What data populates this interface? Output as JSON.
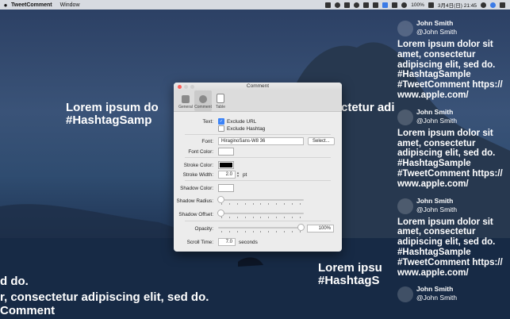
{
  "menubar": {
    "app_name": "TweetComment",
    "menus": [
      "Window"
    ],
    "battery": "100%",
    "clock": "3月4日(日) 21:45"
  },
  "tweets": [
    {
      "name": "John Smith",
      "handle": "@John Smith",
      "body": "Lorem ipsum dolor sit amet, consectetur adipiscing elit, sed do. #HashtagSample #TweetComment https:// www.apple.com/"
    },
    {
      "name": "John Smith",
      "handle": "@John Smith",
      "body": "Lorem ipsum dolor sit amet, consectetur adipiscing elit, sed do. #HashtagSample #TweetComment https:// www.apple.com/"
    },
    {
      "name": "John Smith",
      "handle": "@John Smith",
      "body": "Lorem ipsum dolor sit amet, consectetur adipiscing elit, sed do. #HashtagSample #TweetComment https:// www.apple.com/"
    },
    {
      "name": "John Smith",
      "handle": "@John Smith",
      "body": ""
    }
  ],
  "scrolling": {
    "t1a": "Lorem ipsum do",
    "t1b": "#HashtagSamp",
    "t2": "ctetur adi",
    "t3a": "Lorem ipsu",
    "t3b": "#HashtagS",
    "t4": "d do.",
    "t5": "r, consectetur adipiscing elit, sed do.",
    "t6": "Comment"
  },
  "window": {
    "title": "Comment",
    "tabs": [
      "General",
      "Comment",
      "Table"
    ],
    "text_label": "Text:",
    "exclude_url": "Exclude URL",
    "exclude_hashtag": "Exclude Hashtag",
    "font_label": "Font:",
    "font_value": "HiraginoSans-W8 36",
    "select_button": "Select...",
    "font_color_label": "Font Color:",
    "stroke_color_label": "Stroke Color:",
    "stroke_width_label": "Stroke Width:",
    "stroke_width_value": "2.0",
    "stroke_unit": "pt",
    "shadow_color_label": "Shadow Color:",
    "shadow_radius_label": "Shadow Radius:",
    "shadow_offset_label": "Shadow Offset:",
    "opacity_label": "Opacity:",
    "opacity_value": "100%",
    "scroll_time_label": "Scroll Time:",
    "scroll_time_value": "7.0",
    "scroll_time_unit": "seconds"
  },
  "colors": {
    "font_color": "#ffffff",
    "stroke_color": "#000000",
    "shadow_color": "#ffffff",
    "accent": "#3a82f7"
  },
  "settings": {
    "exclude_url_checked": true,
    "exclude_hashtag_checked": false,
    "shadow_radius_level": 0,
    "shadow_offset_level": 0,
    "opacity_level": 1.0
  }
}
